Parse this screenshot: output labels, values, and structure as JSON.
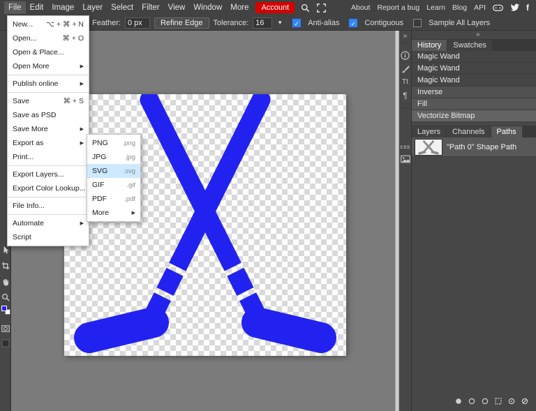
{
  "colors": {
    "accent_blue": "#2e86ff",
    "stick_blue": "#2222f0",
    "submenu_highlight": "#cde9ff",
    "account_red": "#d40000"
  },
  "icons": {
    "submenu_arrow": "▶",
    "dropdown_arrow": "▼",
    "close": "×",
    "collapse_arrows": "»",
    "check": "✓",
    "facebook": "f",
    "text_tool": "Tt",
    "paragraph": "¶",
    "css": "css"
  },
  "menubar": {
    "items": [
      "File",
      "Edit",
      "Image",
      "Layer",
      "Select",
      "Filter",
      "View",
      "Window",
      "More"
    ],
    "account_label": "Account",
    "right_links": [
      "About",
      "Report a bug",
      "Learn",
      "Blog",
      "API"
    ]
  },
  "options_bar": {
    "feather_label": "Feather:",
    "feather_value": "0 px",
    "refine_edge_label": "Refine Edge",
    "tolerance_label": "Tolerance:",
    "tolerance_value": "16",
    "checkboxes": [
      {
        "label": "Anti-alias",
        "checked": true
      },
      {
        "label": "Contiguous",
        "checked": true
      },
      {
        "label": "Sample All Layers",
        "checked": false
      }
    ]
  },
  "file_menu": {
    "items": [
      {
        "label": "New...",
        "shortcut": "⌥ + ⌘ + N"
      },
      {
        "label": "Open...",
        "shortcut": "⌘ + O"
      },
      {
        "label": "Open & Place..."
      },
      {
        "label": "Open More"
      },
      {
        "label": "Publish online"
      },
      {
        "label": "Save",
        "shortcut": "⌘ + S"
      },
      {
        "label": "Save as PSD"
      },
      {
        "label": "Save More"
      },
      {
        "label": "Export as"
      },
      {
        "label": "Print..."
      },
      {
        "label": "Export Layers..."
      },
      {
        "label": "Export Color Lookup..."
      },
      {
        "label": "File Info..."
      },
      {
        "label": "Automate"
      },
      {
        "label": "Script"
      }
    ]
  },
  "export_submenu": {
    "highlighted": "SVG",
    "items": [
      {
        "label": "PNG",
        "ext": ".png"
      },
      {
        "label": "JPG",
        "ext": ".jpg"
      },
      {
        "label": "SVG",
        "ext": ".svg"
      },
      {
        "label": "GIF",
        "ext": ".gif"
      },
      {
        "label": "PDF",
        "ext": ".pdf"
      },
      {
        "label": "More"
      }
    ]
  },
  "history_panel": {
    "tabs": [
      "History",
      "Swatches"
    ],
    "active_tab": "History",
    "items": [
      "Magic Wand",
      "Magic Wand",
      "Magic Wand",
      "Inverse",
      "Fill",
      "Vectorize Bitmap"
    ],
    "current_state": "Vectorize Bitmap"
  },
  "layers_panel": {
    "tabs": [
      "Layers",
      "Channels",
      "Paths"
    ],
    "active_tab": "Paths",
    "path_item_label": "\"Path 0\" Shape Path"
  }
}
